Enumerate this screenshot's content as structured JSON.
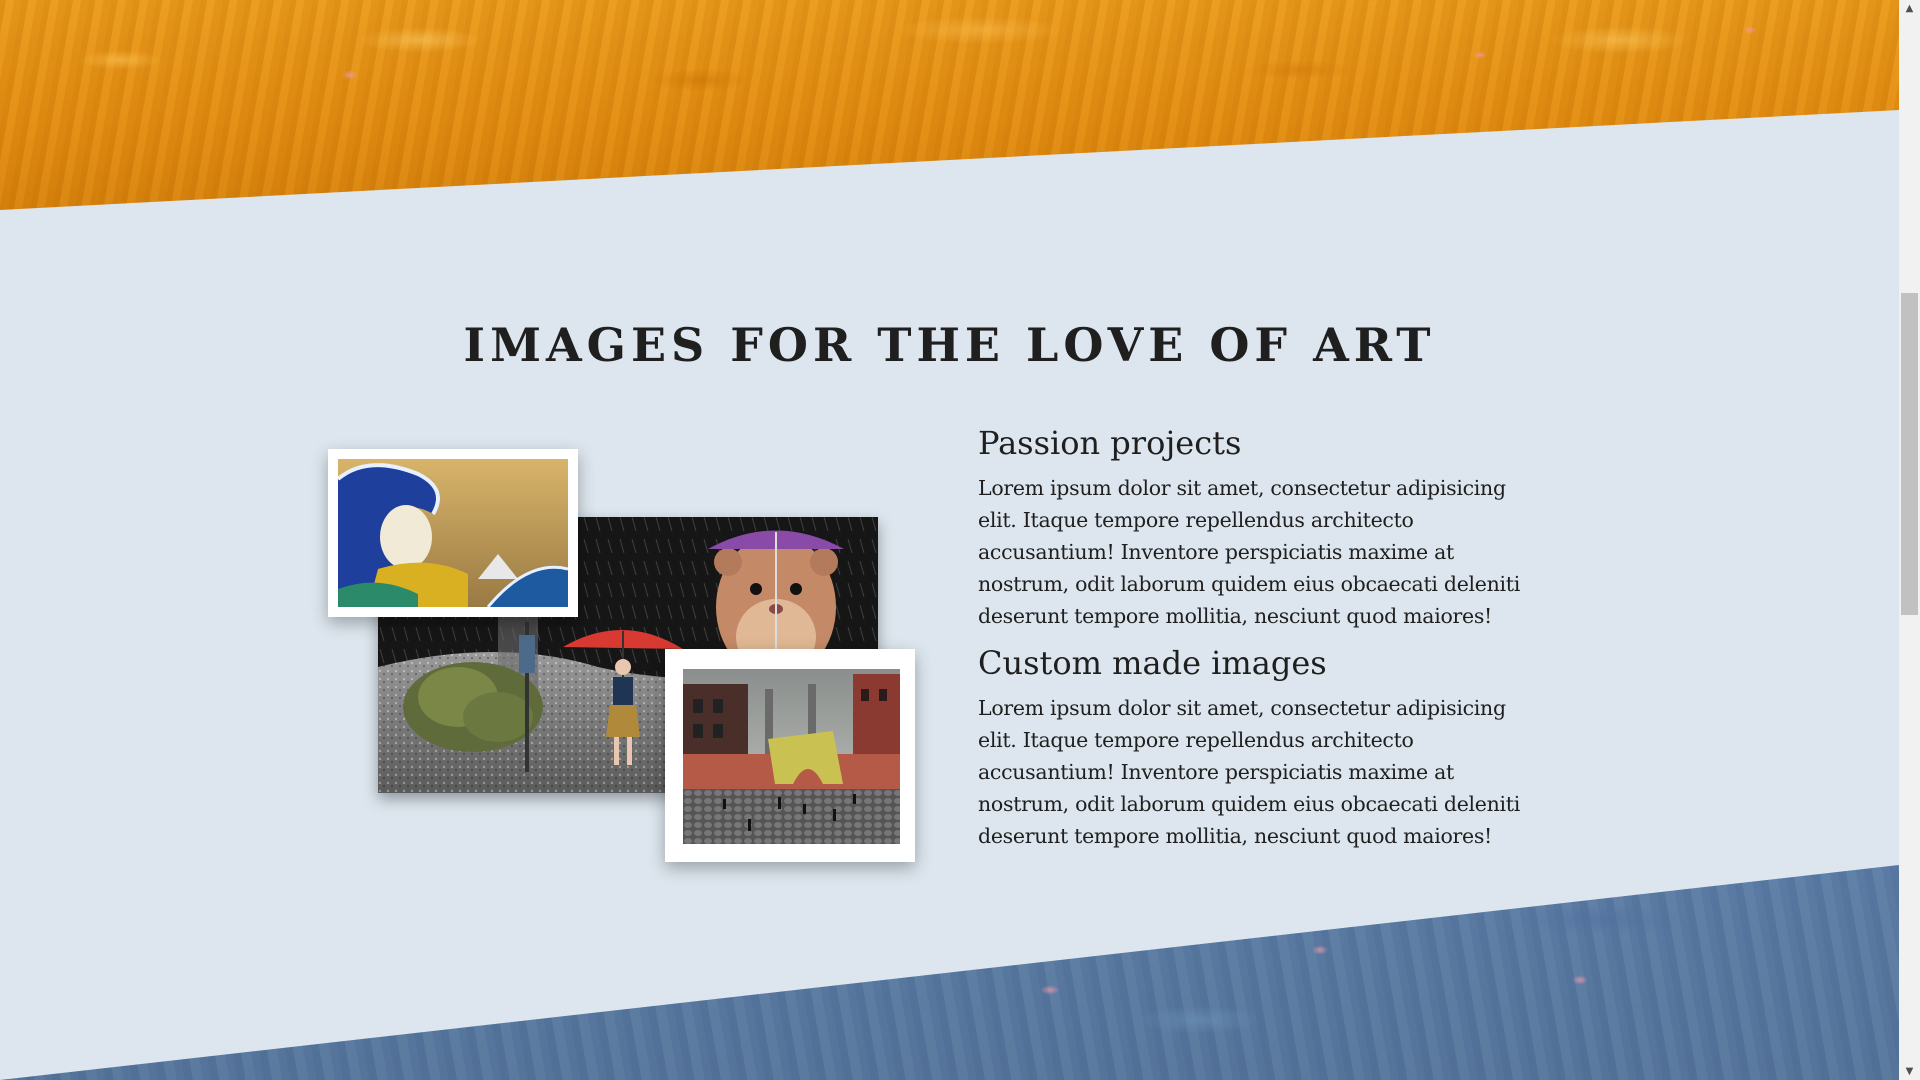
{
  "section": {
    "title": "IMAGES FOR THE LOVE OF ART"
  },
  "images": [
    {
      "id": "wave",
      "subject": "surreal ocean wave artwork"
    },
    {
      "id": "hamster",
      "subject": "hamster with purple umbrella in rain, woman with red umbrella"
    },
    {
      "id": "city",
      "subject": "surreal city square with yellow gate"
    }
  ],
  "features": [
    {
      "heading": "Passion projects",
      "body": "Lorem ipsum dolor sit amet, consectetur adipisicing elit. Itaque tempore repellendus architecto accusantium! Inventore perspiciatis maxime at nostrum, odit laborum quidem eius obcaecati deleniti deserunt tempore mollitia, nesciunt quod maiores!"
    },
    {
      "heading": "Custom made images",
      "body": "Lorem ipsum dolor sit amet, consectetur adipisicing elit. Itaque tempore repellendus architecto accusantium! Inventore perspiciatis maxime at nostrum, odit laborum quidem eius obcaecati deleniti deserunt tempore mollitia, nesciunt quod maiores!"
    }
  ],
  "colors": {
    "section_bg": "#dde6ee",
    "top_band": "#e08a10",
    "bottom_band": "#5d7ea5",
    "text": "#1f1f1f"
  },
  "scrollbar": {
    "up_icon": "chevron-up-icon",
    "down_icon": "chevron-down-icon"
  }
}
